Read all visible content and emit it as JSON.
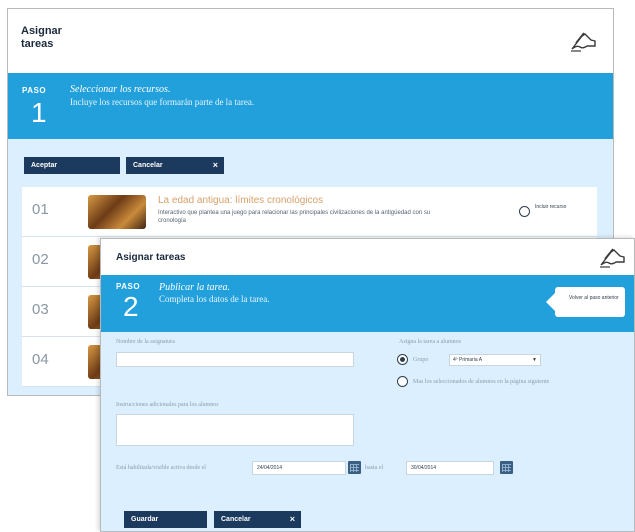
{
  "panel1": {
    "title": "Asignar tareas",
    "step_label": "PASO",
    "step_number": "1",
    "step_title": "Seleccionar los recursos.",
    "step_description": "Incluye los recursos que formarán parte de la tarea.",
    "accept_label": "Aceptar",
    "cancel_label": "Cancelar",
    "cancel_icon": "×",
    "rows": [
      {
        "number": "01",
        "title": "La edad antigua: límites cronológicos",
        "description": "Interactivo que plantea una juego para relacionar las principales civilizaciones de la antigüedad con su cronología",
        "radio_label": "Incluir recurso"
      },
      {
        "number": "02"
      },
      {
        "number": "03"
      },
      {
        "number": "04"
      }
    ]
  },
  "panel2": {
    "title": "Asignar tareas",
    "step_label": "PASO",
    "step_number": "2",
    "step_title": "Publicar la tarea.",
    "step_description": "Completa los datos de la tarea.",
    "back_label": "Volver al paso anterior",
    "subject_name_label": "Nombre de la asignatura",
    "assign_label": "Asigna la tarea a alumnos",
    "group_label": "Grupo",
    "group_value": "4º Primaria A",
    "select_students_label": "Mas los seleccionados de alumnos en la página siguiente",
    "instructions_label": "Instrucciones adicionales para los alumnos",
    "active_from_label": "Está habilitada/visible activa desde el",
    "date_from_value": "24/04/2014",
    "until_label": "hasta el",
    "date_to_value": "30/04/2014",
    "save_label": "Guardar",
    "cancel_label": "Cancelar",
    "cancel_icon": "×"
  }
}
